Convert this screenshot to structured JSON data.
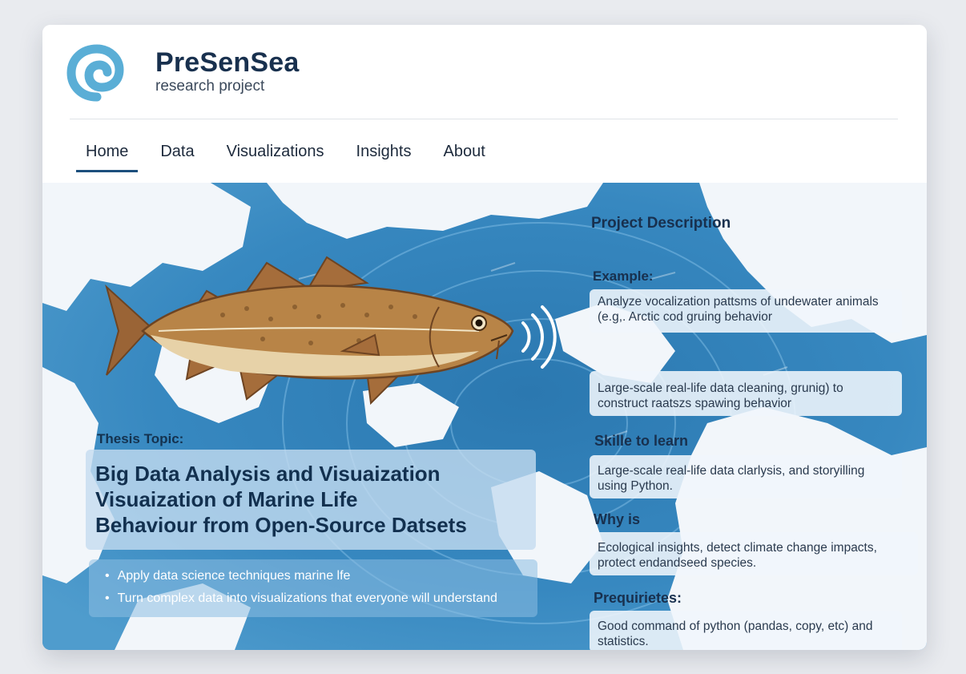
{
  "brand": {
    "name": "PreSenSea",
    "subtitle": "research project"
  },
  "nav": {
    "items": [
      "Home",
      "Data",
      "Visualizations",
      "Insights",
      "About"
    ],
    "active": "Home"
  },
  "hero": {
    "thesis_label": "Thesis Topic:",
    "thesis_title_lines": [
      "Big Data Analysis and Visuaization",
      "Visuaization of Marine Life",
      "Behaviour from Open-Source Datsets"
    ],
    "bullets": [
      "Apply data science techniques marine lfe",
      "Turn complex data into visualizations that everyone will understand"
    ]
  },
  "sidebar": {
    "project_description_heading": "Project Description",
    "example_heading": "Example:",
    "example_text": "Analyze vocalization pattsms of undewater animals (e.g,. Arctic cod gruing behavior",
    "task_text": "Large-scale real-life data cleaning, grunig) to construct raatszs spawing behavior",
    "skills_heading": "Skille to learn",
    "skills_text": "Large-scale real-life data clarlysis, and storyilling using Python.",
    "why_heading": "Why is",
    "why_text": "Ecological insights, detect climate change impacts, protect endandseed species.",
    "prereq_heading": "Prequirietes:",
    "prereq_text": "Good command of python (pandas, copy, etc) and statistics."
  },
  "colors": {
    "brand_text": "#18304e",
    "logo_blue": "#5aaed6",
    "ocean_blue": "#2f7db5",
    "land_white": "#f2f6fa",
    "active_underline": "#1c4f7d"
  },
  "icons": {
    "logo": "spiral-logo-icon",
    "illustration": "arctic-cod-fish-illustration",
    "sound": "sound-wave-icon"
  }
}
